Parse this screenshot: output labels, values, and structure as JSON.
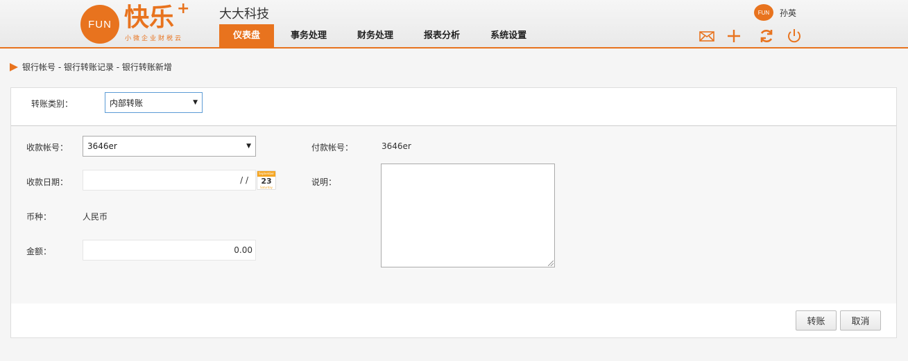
{
  "header": {
    "logo_badge": "FUN",
    "logo_text": "快乐",
    "logo_plus": "+",
    "logo_subtitle": "小微企业财税云",
    "company": "大大科技",
    "nav": [
      "仪表盘",
      "事务处理",
      "财务处理",
      "报表分析",
      "系统设置"
    ],
    "active_nav": "仪表盘",
    "user_avatar": "FUN",
    "user_name": "孙英",
    "icons": [
      "mail-icon",
      "plus-icon",
      "refresh-icon",
      "power-icon"
    ],
    "accent_color": "#e8731e"
  },
  "breadcrumb": "银行帐号 - 银行转账记录 - 银行转账新增",
  "form": {
    "transfer_type_label": "转账类别：",
    "transfer_type_value": "内部转账",
    "receive_account_label": "收款帐号：",
    "receive_account_value": "3646er",
    "receive_date_label": "收款日期：",
    "receive_date_value": "/ /",
    "calendar": {
      "month": "September",
      "day": "23",
      "weekday": "Saturday"
    },
    "currency_label": "币种：",
    "currency_value": "人民币",
    "amount_label": "金额：",
    "amount_value": "0.00",
    "pay_account_label": "付款帐号：",
    "pay_account_value": "3646er",
    "note_label": "说明：",
    "note_value": ""
  },
  "buttons": {
    "transfer": "转账",
    "cancel": "取消"
  }
}
